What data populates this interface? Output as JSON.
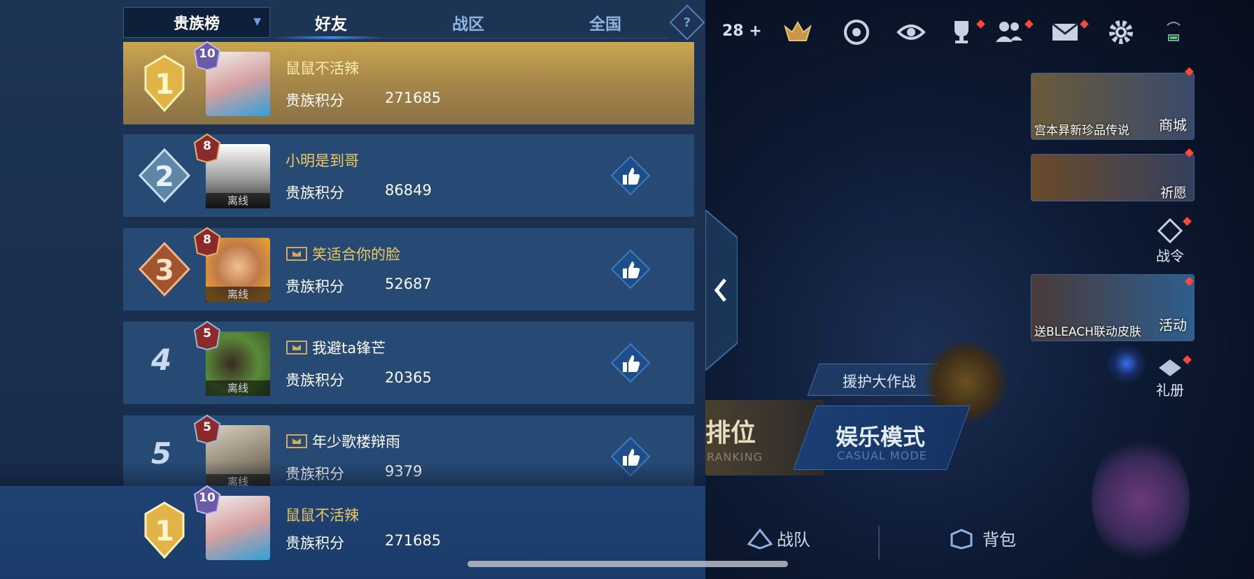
{
  "header": {
    "dropdown_label": "贵族榜",
    "tabs": [
      {
        "label": "好友",
        "active": true
      },
      {
        "label": "战区",
        "active": false
      },
      {
        "label": "全国",
        "active": false
      }
    ],
    "help_label": "?"
  },
  "score_label": "贵族积分",
  "offline_label": "离线",
  "rows": [
    {
      "rank": "1",
      "level": "10",
      "name": "鼠鼠不活辣",
      "score": "271685",
      "offline": false,
      "team": false,
      "like": false
    },
    {
      "rank": "2",
      "level": "8",
      "name": "小明是到哥",
      "score": "86849",
      "offline": true,
      "team": false,
      "like": true
    },
    {
      "rank": "3",
      "level": "8",
      "name": "笑适合你的脸",
      "score": "52687",
      "offline": true,
      "team": true,
      "like": true
    },
    {
      "rank": "4",
      "level": "5",
      "name": "我避ta锋芒",
      "score": "20365",
      "offline": true,
      "team": true,
      "like": true
    },
    {
      "rank": "5",
      "level": "5",
      "name": "年少歌楼辩雨",
      "score": "9379",
      "offline": true,
      "team": true,
      "like": true
    }
  ],
  "self": {
    "rank": "1",
    "level": "10",
    "name": "鼠鼠不活辣",
    "score": "271685"
  },
  "lobby": {
    "count": "28",
    "cards": [
      {
        "caption": "宫本昪新珍品传说",
        "label": "商城"
      },
      {
        "caption": "",
        "label": "祈愿"
      },
      {
        "caption": "送BLEACH联动皮肤",
        "label": "活动"
      }
    ],
    "side_labels": {
      "battle_pass": "战令",
      "gift": "礼册"
    },
    "event_label": "援护大作战",
    "ranked_label": "排位",
    "ranked_sub": "RANKING",
    "casual_label": "娱乐模式",
    "casual_sub": "CASUAL MODE",
    "nav": {
      "team": "战队",
      "bag": "背包"
    }
  },
  "colors": {
    "gold": "#f0c860",
    "panel": "#274a74",
    "accent": "#4aa0ff",
    "red_dot": "#ff4a3a"
  }
}
